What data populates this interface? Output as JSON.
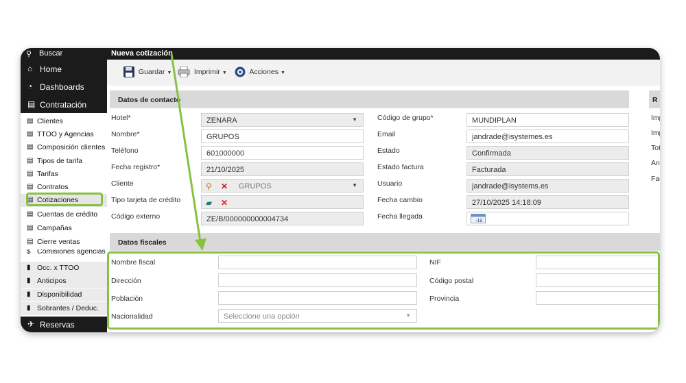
{
  "sidebar": {
    "search_label": "Buscar",
    "home_label": "Home",
    "dashboards_label": "Dashboards",
    "contratacion_label": "Contratación",
    "items": [
      {
        "label": "Clientes"
      },
      {
        "label": "TTOO y Agencias"
      },
      {
        "label": "Composición clientes"
      },
      {
        "label": "Tipos de tarifa"
      },
      {
        "label": "Tarifas"
      },
      {
        "label": "Contratos"
      },
      {
        "label": "Cotizaciones"
      },
      {
        "label": "Cuentas de crédito"
      },
      {
        "label": "Campañas"
      },
      {
        "label": "Cierre ventas"
      },
      {
        "label": "Comisiones agencias"
      },
      {
        "label": "Occ. x TTOO"
      },
      {
        "label": "Anticipos"
      },
      {
        "label": "Disponibilidad"
      },
      {
        "label": "Sobrantes / Deduc."
      }
    ],
    "reservas_label": "Reservas"
  },
  "header": {
    "title": "Nueva cotización"
  },
  "toolbar": {
    "save_label": "Guardar",
    "print_label": "Imprimir",
    "actions_label": "Acciones"
  },
  "contact": {
    "section_title": "Datos de contacto",
    "hotel_label": "Hotel*",
    "hotel_value": "ZENARA",
    "nombre_label": "Nombre*",
    "nombre_value": "GRUPOS",
    "telefono_label": "Teléfono",
    "telefono_value": "601000000",
    "fecha_registro_label": "Fecha registro*",
    "fecha_registro_value": "21/10/2025",
    "cliente_label": "Cliente",
    "cliente_value": "GRUPOS",
    "tarjeta_label": "Tipo tarjeta de crédito",
    "codigo_externo_label": "Código externo",
    "codigo_externo_value": "ZE/B/000000000004734",
    "codigo_grupo_label": "Código de grupo*",
    "codigo_grupo_value": "MUNDIPLAN",
    "email_label": "Email",
    "email_value": "jandrade@isystemes.es",
    "estado_label": "Estado",
    "estado_value": "Confirmada",
    "estado_factura_label": "Estado factura",
    "estado_factura_value": "Facturada",
    "usuario_label": "Usuario",
    "usuario_value": "jandrade@isystems.es",
    "fecha_cambio_label": "Fecha cambio",
    "fecha_cambio_value": "27/10/2025 14:18:09",
    "fecha_llegada_label": "Fecha llegada"
  },
  "right_panel": {
    "header_fragment": "R",
    "labels": [
      "Imp",
      "Imp",
      "Tot",
      "Ant",
      "Fac"
    ]
  },
  "fiscal": {
    "section_title": "Datos fiscales",
    "nombre_fiscal_label": "Nombre fiscal",
    "direccion_label": "Dirección",
    "poblacion_label": "Población",
    "nacionalidad_label": "Nacionalidad",
    "nacionalidad_placeholder": "Seleccione una opción",
    "nif_label": "NIF",
    "codigo_postal_label": "Código postal",
    "provincia_label": "Provincia"
  },
  "colors": {
    "highlight": "#86c240",
    "sidebar_dark": "#1b1b1b",
    "section_header": "#d9d9d9"
  }
}
